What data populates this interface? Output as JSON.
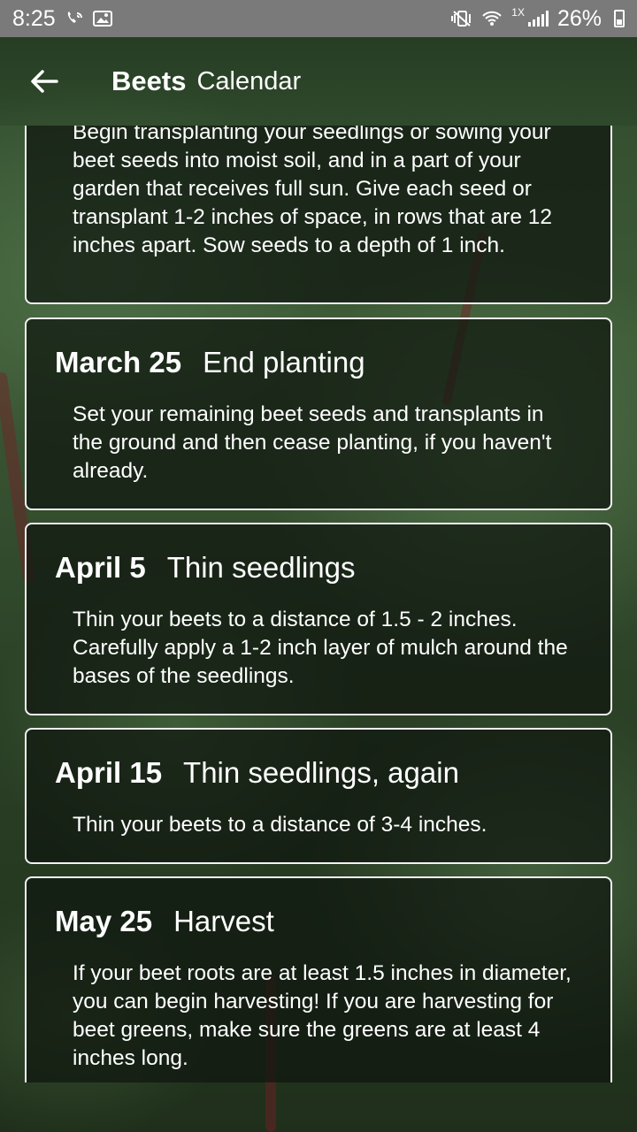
{
  "status_bar": {
    "time": "8:25",
    "left_icons": [
      "wifi-calling-icon",
      "image-icon"
    ],
    "right_icons": [
      "vibrate-icon",
      "wifi-icon",
      "signal-icon",
      "battery-icon"
    ],
    "network_badge": "1X",
    "battery": "26%"
  },
  "app_bar": {
    "back_icon": "arrow-left-icon",
    "title": "Beets",
    "subtitle": "Calendar"
  },
  "events": [
    {
      "date": "",
      "title": "",
      "description": "Begin transplanting your seedlings or sowing your beet seeds into moist soil, and in a part of your garden that receives full sun. Give each seed or transplant 1-2 inches of space, in rows that are 12 inches apart. Sow seeds to a depth of 1 inch."
    },
    {
      "date": "March 25",
      "title": "End planting",
      "description": "Set your remaining beet seeds and transplants in the ground and then cease planting, if you haven't already."
    },
    {
      "date": "April 5",
      "title": "Thin seedlings",
      "description": "Thin your beets to a distance of 1.5 - 2 inches. Carefully apply a 1-2 inch layer of mulch around the bases of the seedlings."
    },
    {
      "date": "April 15",
      "title": "Thin seedlings, again",
      "description": "Thin your beets to a distance of 3-4 inches."
    },
    {
      "date": "May 25",
      "title": "Harvest",
      "description": "If your beet roots are at least 1.5 inches in diameter, you can begin harvesting! If you are harvesting for beet greens, make sure the greens are at least 4 inches long."
    }
  ]
}
